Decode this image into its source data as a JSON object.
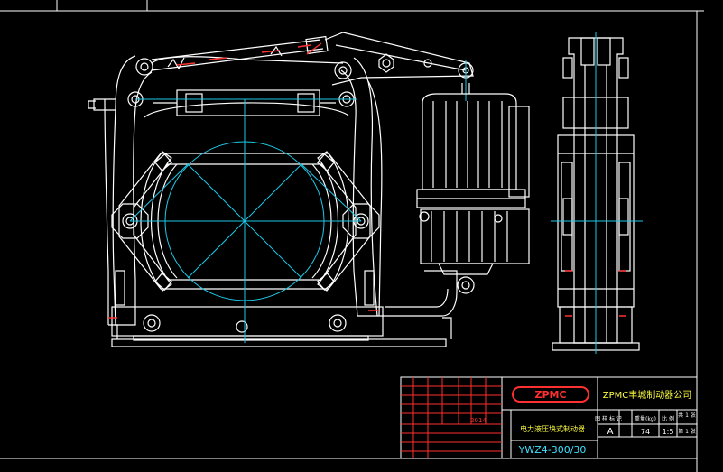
{
  "drawing": {
    "colors": {
      "background": "#000000",
      "outline": "#ffffff",
      "centerline": "#1ec8e6",
      "accent_red": "#ff3030",
      "title_text": "#ffff40",
      "model_text": "#40e0ff"
    }
  },
  "title_block": {
    "logo": "ZPMC",
    "company": "ZPMC丰城制动器公司",
    "product_name": "电力液压块式制动器",
    "model": "YWZ4-300/30",
    "year": "2014",
    "scale_value": "1:5",
    "weight_value": "74",
    "stage_mark": "A",
    "sheet": "第 1 张",
    "sheets_total": "共 1 张",
    "header_labels": [
      "图 样 标 记",
      "重量(kg)",
      "比 例"
    ]
  }
}
